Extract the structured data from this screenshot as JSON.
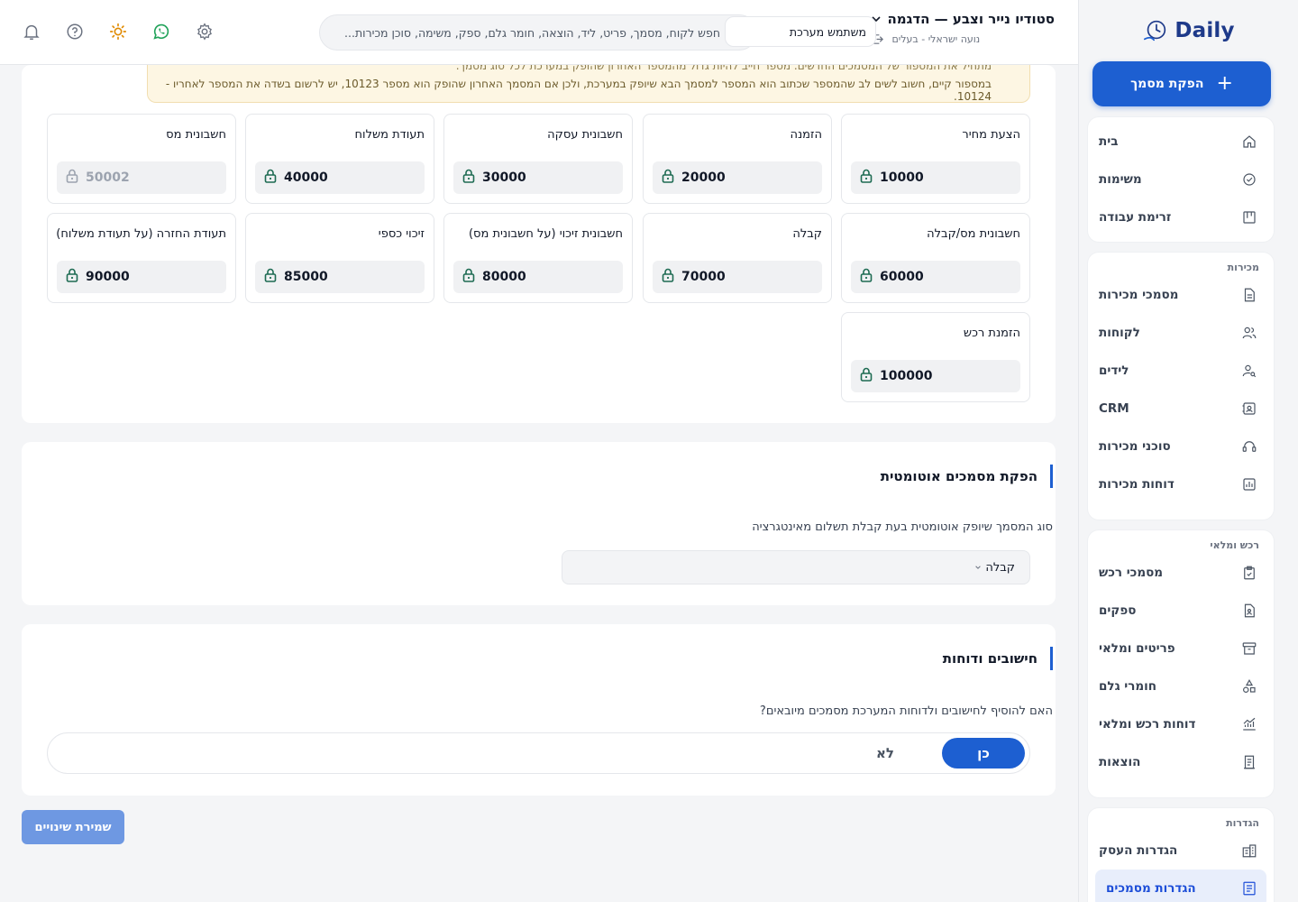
{
  "brand": {
    "logo_text": "Daily",
    "accent": "#1d5fd1"
  },
  "sidebar": {
    "cta_label": "הפקת מסמך",
    "groups": [
      {
        "title": "",
        "items": [
          {
            "label": "בית",
            "icon": "home-icon"
          },
          {
            "label": "משימות",
            "icon": "check-circle-icon"
          },
          {
            "label": "זרימת עבודה",
            "icon": "kanban-icon"
          }
        ]
      },
      {
        "title": "מכירות",
        "items": [
          {
            "label": "מסמכי מכירות",
            "icon": "document-icon"
          },
          {
            "label": "לקוחות",
            "icon": "users-icon"
          },
          {
            "label": "לידים",
            "icon": "user-search-icon"
          },
          {
            "label": "CRM",
            "icon": "contact-card-icon"
          },
          {
            "label": "סוכני מכירות",
            "icon": "headset-icon"
          },
          {
            "label": "דוחות מכירות",
            "icon": "bar-chart-icon"
          }
        ]
      },
      {
        "title": "רכש ומלאי",
        "items": [
          {
            "label": "מסמכי רכש",
            "icon": "clipboard-check-icon"
          },
          {
            "label": "ספקים",
            "icon": "file-user-icon"
          },
          {
            "label": "פריטים ומלאי",
            "icon": "archive-icon"
          },
          {
            "label": "חומרי גלם",
            "icon": "shapes-icon"
          },
          {
            "label": "דוחות רכש ומלאי",
            "icon": "line-chart-icon"
          },
          {
            "label": "הוצאות",
            "icon": "receipt-icon"
          }
        ]
      },
      {
        "title": "הגדרות",
        "items": [
          {
            "label": "הגדרות העסק",
            "icon": "building-icon"
          },
          {
            "label": "הגדרות מסמכים",
            "icon": "file-settings-icon",
            "active": true
          }
        ]
      }
    ]
  },
  "header": {
    "org_name": "סטודיו נייר וצבע — הדגמה",
    "user_line": "נועה ישראלי - בעלים",
    "user_select_value": "משתמש מערכת",
    "search_placeholder": "חפש לקוח, מסמך, פריט, ליד, הוצאה, חומר גלם, ספק, משימה, סוכן מכירות...",
    "icons": [
      "bell-icon",
      "help-icon",
      "sun-icon",
      "whatsapp-icon",
      "gear-icon"
    ]
  },
  "numbering": {
    "alert_top_clipped": "מתחיל את המספור של המסמכים החדשים. מספר חייב להיות גדול מהמספר האחרון שהופק במערכת לכל סוג מסמך.",
    "alert_text": "במספור קיים, חשוב לשים לב שהמספר שכתוב הוא המספר למסמך הבא שיופק במערכת, ולכן אם המסמך האחרון שהופק הוא מספר 10123, יש לרשום בשדה את המספר לאחריו - 10124.",
    "cards": [
      {
        "label": "הצעת מחיר",
        "value": "10000",
        "locked": true
      },
      {
        "label": "הזמנה",
        "value": "20000",
        "locked": true
      },
      {
        "label": "חשבונית עסקה",
        "value": "30000",
        "locked": true
      },
      {
        "label": "תעודת משלוח",
        "value": "40000",
        "locked": true
      },
      {
        "label": "חשבונית מס",
        "value": "50002",
        "locked": true,
        "dim": true
      },
      {
        "label": "חשבונית מס/קבלה",
        "value": "60000",
        "locked": true
      },
      {
        "label": "קבלה",
        "value": "70000",
        "locked": true
      },
      {
        "label": "חשבונית זיכוי (על חשבונית מס)",
        "value": "80000",
        "locked": true
      },
      {
        "label": "זיכוי כספי",
        "value": "85000",
        "locked": true
      },
      {
        "label": "תעודת החזרה (על תעודת משלוח)",
        "value": "90000",
        "locked": true
      },
      {
        "label": "הזמנת רכש",
        "value": "100000",
        "locked": true
      }
    ]
  },
  "auto_docs": {
    "title": "הפקת מסמכים אוטומטית",
    "field_label": "סוג המסמך שיופק אוטומטית בעת קבלת תשלום מאינטגרציה",
    "selected": "קבלה"
  },
  "reports": {
    "title": "חישובים ודוחות",
    "question": "האם להוסיף לחישובים ולדוחות המערכת מסמכים מיובאים?",
    "yes_label": "כן",
    "no_label": "לא",
    "selected": "כן"
  },
  "save_label": "שמירת שינויים"
}
